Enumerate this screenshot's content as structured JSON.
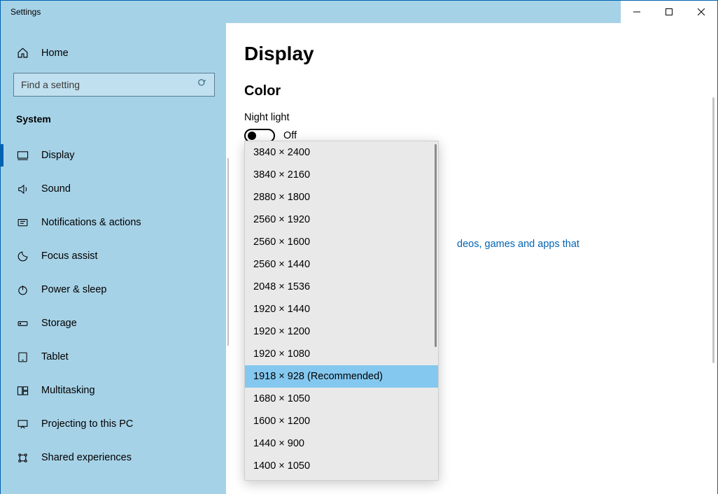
{
  "window": {
    "title": "Settings"
  },
  "sidebar": {
    "home": "Home",
    "search_placeholder": "Find a setting",
    "section": "System",
    "items": [
      {
        "label": "Display",
        "active": true,
        "icon": "display-icon"
      },
      {
        "label": "Sound",
        "active": false,
        "icon": "sound-icon"
      },
      {
        "label": "Notifications & actions",
        "active": false,
        "icon": "notifications-icon"
      },
      {
        "label": "Focus assist",
        "active": false,
        "icon": "focus-assist-icon"
      },
      {
        "label": "Power & sleep",
        "active": false,
        "icon": "power-icon"
      },
      {
        "label": "Storage",
        "active": false,
        "icon": "storage-icon"
      },
      {
        "label": "Tablet",
        "active": false,
        "icon": "tablet-icon"
      },
      {
        "label": "Multitasking",
        "active": false,
        "icon": "multitasking-icon"
      },
      {
        "label": "Projecting to this PC",
        "active": false,
        "icon": "projecting-icon"
      },
      {
        "label": "Shared experiences",
        "active": false,
        "icon": "shared-icon"
      }
    ]
  },
  "main": {
    "title": "Display",
    "section_color": "Color",
    "night_light_label": "Night light",
    "night_light_value": "Off",
    "hint_fragment": "deos, games and apps that"
  },
  "dropdown": {
    "options": [
      {
        "label": "3840 × 2400",
        "selected": false
      },
      {
        "label": "3840 × 2160",
        "selected": false
      },
      {
        "label": "2880 × 1800",
        "selected": false
      },
      {
        "label": "2560 × 1920",
        "selected": false
      },
      {
        "label": "2560 × 1600",
        "selected": false
      },
      {
        "label": "2560 × 1440",
        "selected": false
      },
      {
        "label": "2048 × 1536",
        "selected": false
      },
      {
        "label": "1920 × 1440",
        "selected": false
      },
      {
        "label": "1920 × 1200",
        "selected": false
      },
      {
        "label": "1920 × 1080",
        "selected": false
      },
      {
        "label": "1918 × 928 (Recommended)",
        "selected": true
      },
      {
        "label": "1680 × 1050",
        "selected": false
      },
      {
        "label": "1600 × 1200",
        "selected": false
      },
      {
        "label": "1440 × 900",
        "selected": false
      },
      {
        "label": "1400 × 1050",
        "selected": false
      }
    ]
  }
}
